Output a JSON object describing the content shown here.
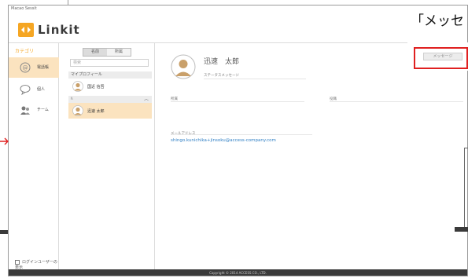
{
  "window": {
    "title": "Macao Sessit"
  },
  "brand": {
    "name": "Linkit"
  },
  "categories": {
    "heading": "カテゴリ",
    "items": [
      {
        "label": "電話帳",
        "icon": "address-book-icon"
      },
      {
        "label": "個人",
        "icon": "chat-bubble-icon"
      },
      {
        "label": "チーム",
        "icon": "team-icon"
      }
    ],
    "footer": "ログインユーザーの表示"
  },
  "list": {
    "segments": [
      "名前",
      "所属"
    ],
    "search_placeholder": "検索",
    "sections": [
      {
        "label": "マイプロフィール",
        "rows": [
          {
            "name": "国近 信吾"
          }
        ]
      },
      {
        "label": "ﾊ",
        "rows": [
          {
            "name": "迅速 太郎"
          }
        ]
      }
    ]
  },
  "detail": {
    "name": "迅速　太郎",
    "status_label": "ステータスメッセージ",
    "field_left": "所属",
    "field_right": "役職",
    "email_label": "メールアドレス",
    "email_value": "shingo.kunichika+jinsoku@access-company.com"
  },
  "footer": {
    "copyright": "Copyright © 2014 ACCESS CO., LTD."
  },
  "overlay": {
    "caption": "「メッセ",
    "message_button": "メッセージ"
  },
  "colors": {
    "accent_orange": "#f5a623",
    "active_row": "#fbe3bf",
    "link_blue": "#2f7fc4",
    "highlight_red": "#e02020",
    "footer_bg": "#3a3a3a"
  }
}
